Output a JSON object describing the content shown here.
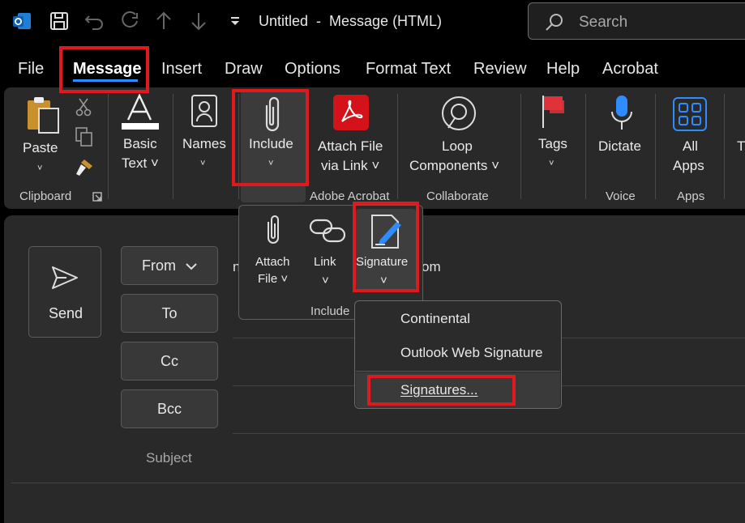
{
  "window": {
    "title": "Untitled  -  Message (HTML)",
    "search_placeholder": "Search"
  },
  "menu": {
    "items": [
      "File",
      "Message",
      "Insert",
      "Draw",
      "Options",
      "Format Text",
      "Review",
      "Help",
      "Acrobat"
    ],
    "active": "Message"
  },
  "ribbon": {
    "paste": "Paste",
    "basic_text": [
      "Basic",
      "Text ˅"
    ],
    "names": "Names",
    "include": "Include",
    "attach_link": [
      "Attach File",
      "via Link ˅"
    ],
    "loop": [
      "Loop",
      "Components ˅"
    ],
    "tags": "Tags",
    "dictate": "Dictate",
    "all_apps": [
      "All",
      "Apps"
    ],
    "cut_off": "T",
    "groups": {
      "clipboard": "Clipboard",
      "adobe": "Adobe Acrobat",
      "collaborate": "Collaborate",
      "voice": "Voice",
      "apps": "Apps"
    }
  },
  "include_panel": {
    "attach_file": [
      "Attach",
      "File ˅"
    ],
    "link": "Link",
    "signature": "Signature",
    "group_label": "Include"
  },
  "signature_menu": {
    "items": [
      "Continental",
      "Outlook Web Signature",
      "Signatures..."
    ]
  },
  "compose": {
    "send": "Send",
    "from": "From",
    "to": "To",
    "cc": "Cc",
    "bcc": "Bcc",
    "subject_placeholder": "Subject",
    "from_value_start": "n",
    "from_value_end": "om"
  },
  "colors": {
    "accent": "#2f8cff",
    "highlight": "#e0191f",
    "acrobat_red": "#d4121a"
  }
}
